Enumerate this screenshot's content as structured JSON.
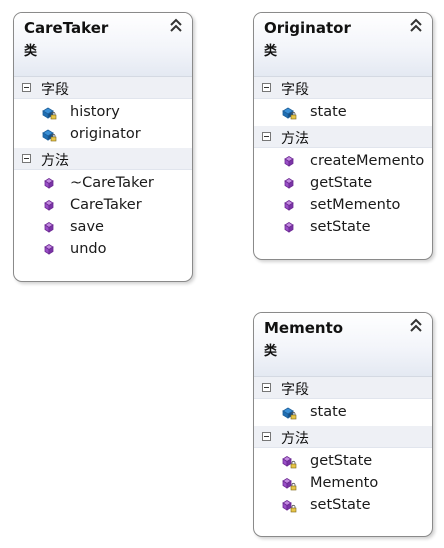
{
  "classes": [
    {
      "name": "CareTaker",
      "stereotype": "类",
      "fields_title": "字段",
      "fields": [
        {
          "name": "history",
          "icon": "private-field-icon"
        },
        {
          "name": "originator",
          "icon": "private-field-icon"
        }
      ],
      "methods_title": "方法",
      "methods": [
        {
          "name": "~CareTaker",
          "icon": "public-method-icon"
        },
        {
          "name": "CareTaker",
          "icon": "public-method-icon"
        },
        {
          "name": "save",
          "icon": "public-method-icon"
        },
        {
          "name": "undo",
          "icon": "public-method-icon"
        }
      ]
    },
    {
      "name": "Originator",
      "stereotype": "类",
      "fields_title": "字段",
      "fields": [
        {
          "name": "state",
          "icon": "private-field-icon"
        }
      ],
      "methods_title": "方法",
      "methods": [
        {
          "name": "createMemento",
          "icon": "public-method-icon"
        },
        {
          "name": "getState",
          "icon": "public-method-icon"
        },
        {
          "name": "setMemento",
          "icon": "public-method-icon"
        },
        {
          "name": "setState",
          "icon": "public-method-icon"
        }
      ]
    },
    {
      "name": "Memento",
      "stereotype": "类",
      "fields_title": "字段",
      "fields": [
        {
          "name": "state",
          "icon": "private-field-icon"
        }
      ],
      "methods_title": "方法",
      "methods": [
        {
          "name": "getState",
          "icon": "private-method-icon"
        },
        {
          "name": "Memento",
          "icon": "private-method-icon"
        },
        {
          "name": "setState",
          "icon": "private-method-icon"
        }
      ]
    }
  ],
  "colors": {
    "field_icon": "#1e6fb5",
    "method_icon": "#8a3fb8",
    "header_bg": "#e4e9f2",
    "border": "#8a8a8a"
  }
}
